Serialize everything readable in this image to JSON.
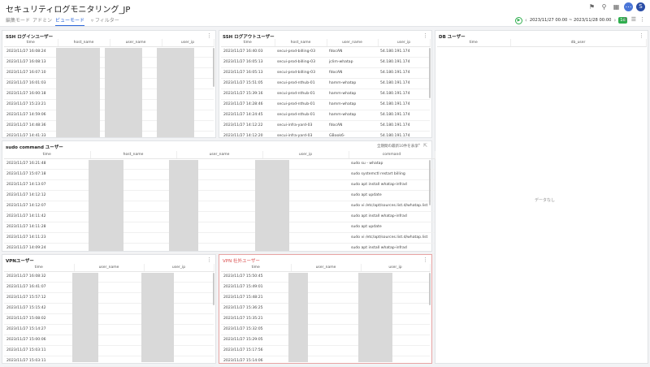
{
  "app": {
    "title": "セキュリティログモニタリング_JP"
  },
  "icons": [
    "megaphone-icon",
    "pin-icon",
    "calendar-icon",
    "more-icon",
    "avatar-icon",
    "play-icon",
    "chevron-left-icon",
    "chevron-right-icon",
    "refresh-icon",
    "list-icon",
    "settings-icon"
  ],
  "tabs": [
    {
      "label": "編集モード"
    },
    {
      "label": "アドミン"
    },
    {
      "label": "ビューモード"
    },
    {
      "label": "フィルター"
    }
  ],
  "time": {
    "range": "2023/11/27 00:00 ~ 2023/11/28 00:00",
    "badge": "1d"
  },
  "avatar_letter": "S",
  "ssh_login": {
    "title": "SSH ログインユーザー",
    "columns": [
      "time",
      "host_name",
      "user_name",
      "user_ip"
    ],
    "rows": [
      "2023/11/27 16:08:24",
      "2023/11/27 16:08:13",
      "2023/11/27 16:07:10",
      "2023/11/27 16:01:03",
      "2023/11/27 16:00:18",
      "2023/11/27 15:23:21",
      "2023/11/27 14:59:06",
      "2023/11/27 14:48:36",
      "2023/11/27 14:41:33"
    ]
  },
  "ssh_logout": {
    "title": "SSH ログアウトユーザー",
    "columns": [
      "time",
      "host_name",
      "user_name",
      "user_ip"
    ],
    "rows": [
      [
        "2023/11/27 16:40:03",
        "secui-prod-billing-03",
        "fdocAN",
        "54.180.191.174"
      ],
      [
        "2023/11/27 16:05:13",
        "secui-prod-billing-03",
        "jclim-whatap",
        "54.180.191.174"
      ],
      [
        "2023/11/27 16:05:13",
        "secui-prod-billing-03",
        "fdocAN",
        "54.180.191.174"
      ],
      [
        "2023/11/27 15:51:05",
        "secui-prod-nthub-01",
        "hamm-whatap",
        "54.180.191.174"
      ],
      [
        "2023/11/27 15:39:16",
        "secui-prod-nthub-01",
        "hamm-whatap",
        "54.180.191.174"
      ],
      [
        "2023/11/27 14:28:46",
        "secui-prod-nthub-01",
        "hamm-whatap",
        "54.180.191.174"
      ],
      [
        "2023/11/27 14:24:45",
        "secui-prod-nthub-01",
        "hamm-whatap",
        "54.180.191.174"
      ],
      [
        "2023/11/27 14:12:22",
        "secui-infra-yard-03",
        "fdocAN",
        "54.180.191.174"
      ],
      [
        "2023/11/27 14:12:20",
        "secui-infra-yard-03",
        "GBook6-",
        "54.180.191.174"
      ]
    ]
  },
  "db_users": {
    "title": "DB ユーザー",
    "columns": [
      "time",
      "db_user"
    ],
    "empty": "データなし"
  },
  "sudo": {
    "title": "sudo command ユーザー",
    "note": "全期間の最新10件を表示",
    "columns": [
      "time",
      "host_name",
      "user_name",
      "user_ip",
      "command"
    ],
    "rows": [
      [
        "2023/11/27 16:21:48",
        "sudo su - whatap"
      ],
      [
        "2023/11/27 15:07:18",
        "sudo systemctl restart billing"
      ],
      [
        "2023/11/27 14:13:07",
        "sudo apt install whatap-infrad"
      ],
      [
        "2023/11/27 14:12:12",
        "sudo apt update"
      ],
      [
        "2023/11/27 14:12:07",
        "sudo vi /etc/apt/sources.list.d/whatap.list"
      ],
      [
        "2023/11/27 14:11:42",
        "sudo apt install whatap-infrad"
      ],
      [
        "2023/11/27 14:11:28",
        "sudo apt update"
      ],
      [
        "2023/11/27 14:11:23",
        "sudo vi /etc/apt/sources.list.d/whatap.list"
      ],
      [
        "2023/11/27 14:09:24",
        "sudo apt install whatap-infrad"
      ]
    ]
  },
  "vpn": {
    "title": "VPNユーザー",
    "columns": [
      "time",
      "user_name",
      "user_ip"
    ],
    "rows": [
      "2023/11/27 16:08:32",
      "2023/11/27 16:41:07",
      "2023/11/27 15:57:12",
      "2023/11/27 15:15:42",
      "2023/11/27 15:08:02",
      "2023/11/27 15:14:27",
      "2023/11/27 15:00:06",
      "2023/11/27 15:03:11",
      "2023/11/27 15:03:11"
    ]
  },
  "vpn_out": {
    "title": "VPN 社外ユーザー",
    "columns": [
      "time",
      "user_name",
      "user_ip"
    ],
    "rows": [
      "2023/11/27 15:50:45",
      "2023/11/27 15:49:01",
      "2023/11/27 15:48:21",
      "2023/11/27 15:36:25",
      "2023/11/27 15:35:21",
      "2023/11/27 15:32:05",
      "2023/11/27 15:29:05",
      "2023/11/27 15:17:56",
      "2023/11/27 15:14:06"
    ]
  }
}
